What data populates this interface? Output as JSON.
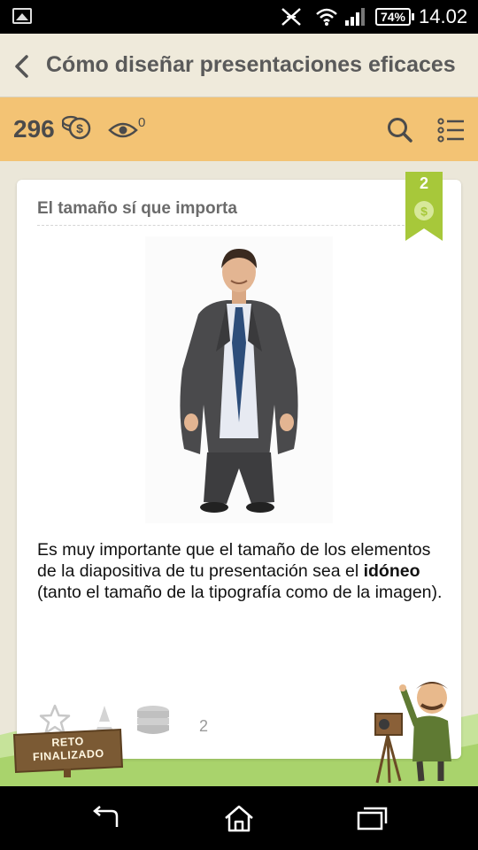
{
  "status_bar": {
    "battery": "74%",
    "time": "14.02"
  },
  "header": {
    "title": "Cómo diseñar presentaciones eficaces"
  },
  "stats": {
    "coins": "296",
    "views": "0"
  },
  "card": {
    "title": "El tamaño sí que importa",
    "reward": "2",
    "text_before": "Es muy importante que el tamaño de los elementos de la diapositiva de tu presentación sea el ",
    "text_bold": "idóneo",
    "text_after": " (tanto el tamaño de la tipografía como de la imagen).",
    "stack_count": "2"
  },
  "stamp": {
    "line1": "RETO",
    "line2": "FINALIZADO"
  },
  "colors": {
    "stats_bar": "#f3c374",
    "title_bar": "#efeadb",
    "ribbon": "#a7c83a",
    "grass": "#a9d36c"
  },
  "icons": [
    "back-icon",
    "coin-icon",
    "eye-icon",
    "search-icon",
    "list-menu-icon",
    "star-icon",
    "cone-icon",
    "coin-stack-icon",
    "nav-back-icon",
    "nav-home-icon",
    "nav-recents-icon"
  ]
}
